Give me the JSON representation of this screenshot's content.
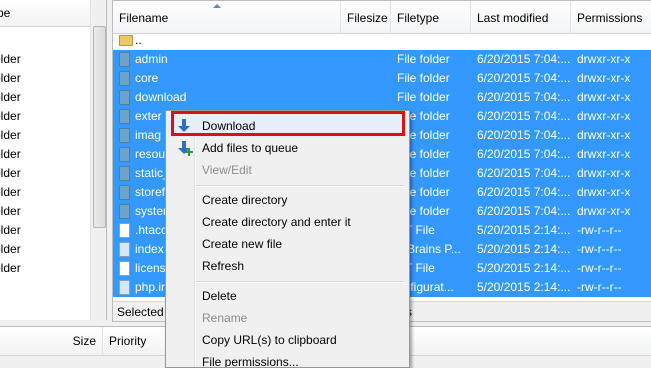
{
  "local": {
    "header_label": "pe",
    "items": [
      "older",
      "older",
      "older",
      "older",
      "older",
      "older",
      "older",
      "older",
      "older",
      "older",
      "older",
      "older"
    ]
  },
  "remote": {
    "columns": {
      "filename": "Filename",
      "filesize": "Filesize",
      "filetype": "Filetype",
      "last_modified": "Last modified",
      "permissions": "Permissions"
    },
    "rows": [
      {
        "name": "..",
        "type": "",
        "modified": "",
        "perm": "",
        "icon": "parent-folder-icon"
      },
      {
        "name": "admin",
        "type": "File folder",
        "modified": "6/20/2015 7:04:...",
        "perm": "drwxr-xr-x",
        "icon": "folder-icon"
      },
      {
        "name": "core",
        "type": "File folder",
        "modified": "6/20/2015 7:04:...",
        "perm": "drwxr-xr-x",
        "icon": "folder-icon"
      },
      {
        "name": "download",
        "type": "File folder",
        "modified": "6/20/2015 7:04:...",
        "perm": "drwxr-xr-x",
        "icon": "folder-icon"
      },
      {
        "name": "exter",
        "type": "File folder",
        "modified": "6/20/2015 7:04:...",
        "perm": "drwxr-xr-x",
        "icon": "folder-icon"
      },
      {
        "name": "imag",
        "type": "File folder",
        "modified": "6/20/2015 7:04:...",
        "perm": "drwxr-xr-x",
        "icon": "folder-icon"
      },
      {
        "name": "resour",
        "type": "File folder",
        "modified": "6/20/2015 7:04:...",
        "perm": "drwxr-xr-x",
        "icon": "folder-icon"
      },
      {
        "name": "static_",
        "type": "File folder",
        "modified": "6/20/2015 7:04:...",
        "perm": "drwxr-xr-x",
        "icon": "folder-icon"
      },
      {
        "name": "storefr",
        "type": "File folder",
        "modified": "6/20/2015 7:04:...",
        "perm": "drwxr-xr-x",
        "icon": "folder-icon"
      },
      {
        "name": "system",
        "type": "File folder",
        "modified": "6/20/2015 7:04:...",
        "perm": "drwxr-xr-x",
        "icon": "folder-icon"
      },
      {
        "name": ".htacc",
        "type": "XT File",
        "modified": "5/20/2015 2:14:...",
        "perm": "-rw-r--r--",
        "icon": "file-icon"
      },
      {
        "name": "index.",
        "type": "etBrains P...",
        "modified": "5/20/2015 2:14:...",
        "perm": "-rw-r--r--",
        "icon": "php-file-icon"
      },
      {
        "name": "licens",
        "type": "XT File",
        "modified": "5/20/2015 2:14:...",
        "perm": "-rw-r--r--",
        "icon": "file-icon"
      },
      {
        "name": "php.ir",
        "type": "onfigurat...",
        "modified": "5/20/2015 2:14:...",
        "perm": "-rw-r--r--",
        "icon": "config-file-icon"
      }
    ],
    "status_left": "Selected 6",
    "status_right": "s"
  },
  "queue": {
    "size_label": "Size",
    "priority_label": "Priority"
  },
  "context_menu": {
    "download": "Download",
    "add_to_queue": "Add files to queue",
    "view_edit": "View/Edit",
    "create_directory": "Create directory",
    "create_directory_enter": "Create directory and enter it",
    "create_new_file": "Create new file",
    "refresh": "Refresh",
    "delete": "Delete",
    "rename": "Rename",
    "copy_url": "Copy URL(s) to clipboard",
    "file_permissions": "File permissions..."
  },
  "colors": {
    "selection": "#3399ff",
    "highlight_box": "#d4141c"
  }
}
